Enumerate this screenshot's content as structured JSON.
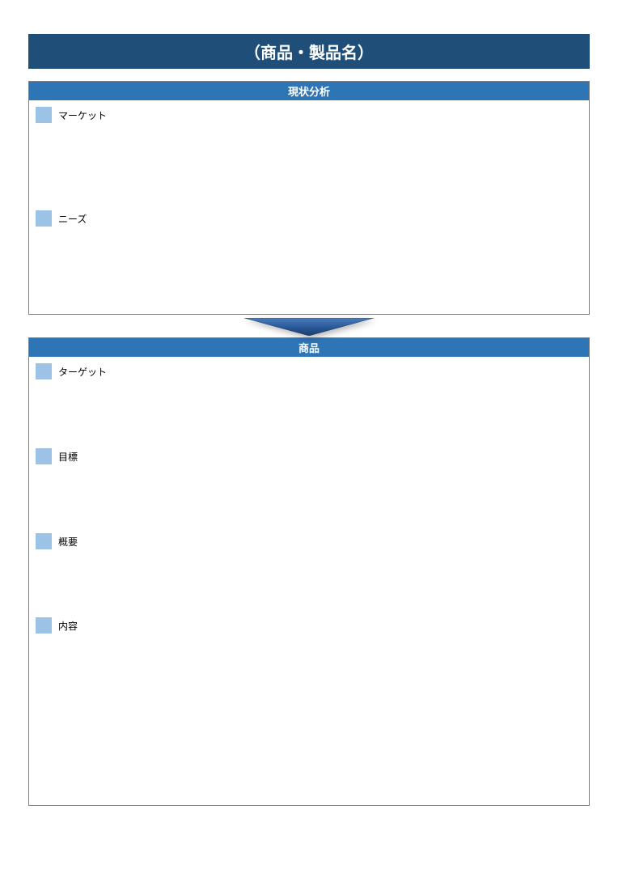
{
  "title": "（商品・製品名）",
  "section1": {
    "header": "現状分析",
    "items": [
      {
        "label": "マーケット"
      },
      {
        "label": "ニーズ"
      }
    ]
  },
  "section2": {
    "header": "商品",
    "items": [
      {
        "label": "ターゲット"
      },
      {
        "label": "目標"
      },
      {
        "label": "概要"
      },
      {
        "label": "内容"
      }
    ]
  }
}
